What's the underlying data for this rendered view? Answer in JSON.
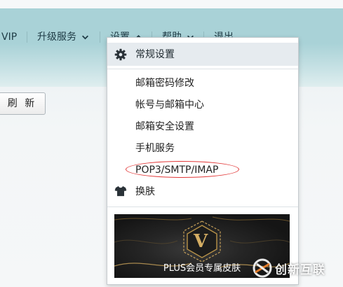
{
  "nav": {
    "vip": "VIP",
    "upgrade": "升级服务",
    "settings": "设置",
    "help": "帮助",
    "logout": "退出"
  },
  "toolbar": {
    "refresh": "刷 新"
  },
  "settings_menu": {
    "general": "常规设置",
    "items": [
      "邮箱密码修改",
      "帐号与邮箱中心",
      "邮箱安全设置",
      "手机服务",
      "POP3/SMTP/IMAP"
    ],
    "skin": "换肤",
    "banner_title": "PLUS会员专属皮肤",
    "banner_logo_letter": "V"
  },
  "watermark": {
    "text": "创新互联"
  },
  "colors": {
    "header": "#a9d2d7",
    "annotation_ring": "#e23838",
    "banner_gold": "#c9a25a"
  }
}
